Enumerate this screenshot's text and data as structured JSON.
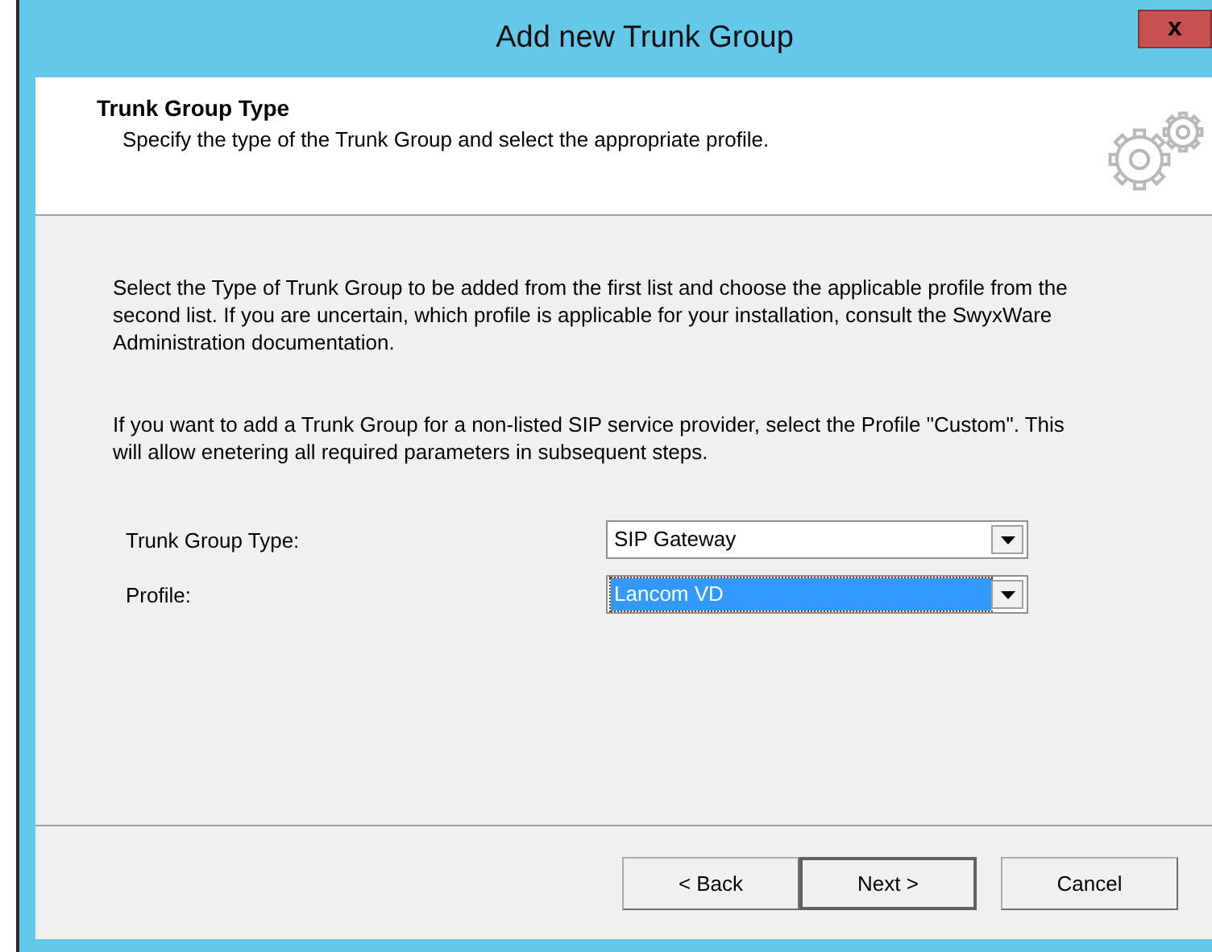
{
  "window": {
    "title": "Add new Trunk Group",
    "close": "x"
  },
  "header": {
    "title": "Trunk Group Type",
    "subtitle": "Specify the type of the Trunk Group and select the appropriate profile."
  },
  "paragraphs": [
    "Select the Type of Trunk Group to be added from the first list and choose the applicable profile from the second list. If you are uncertain, which profile is applicable for your installation, consult the SwyxWare Administration documentation.",
    "If you want to add a Trunk Group for a non-listed SIP service provider, select the Profile \"Custom\". This will allow enetering all required parameters in subsequent steps."
  ],
  "fields": [
    {
      "label": "Trunk Group Type:",
      "value": "SIP Gateway",
      "focused": false
    },
    {
      "label": "Profile:",
      "value": "Lancom VD",
      "focused": true
    }
  ],
  "buttons": [
    {
      "label": "< Back",
      "default": false
    },
    {
      "label": "Next >",
      "default": true
    },
    {
      "label": "Cancel",
      "default": false
    }
  ]
}
